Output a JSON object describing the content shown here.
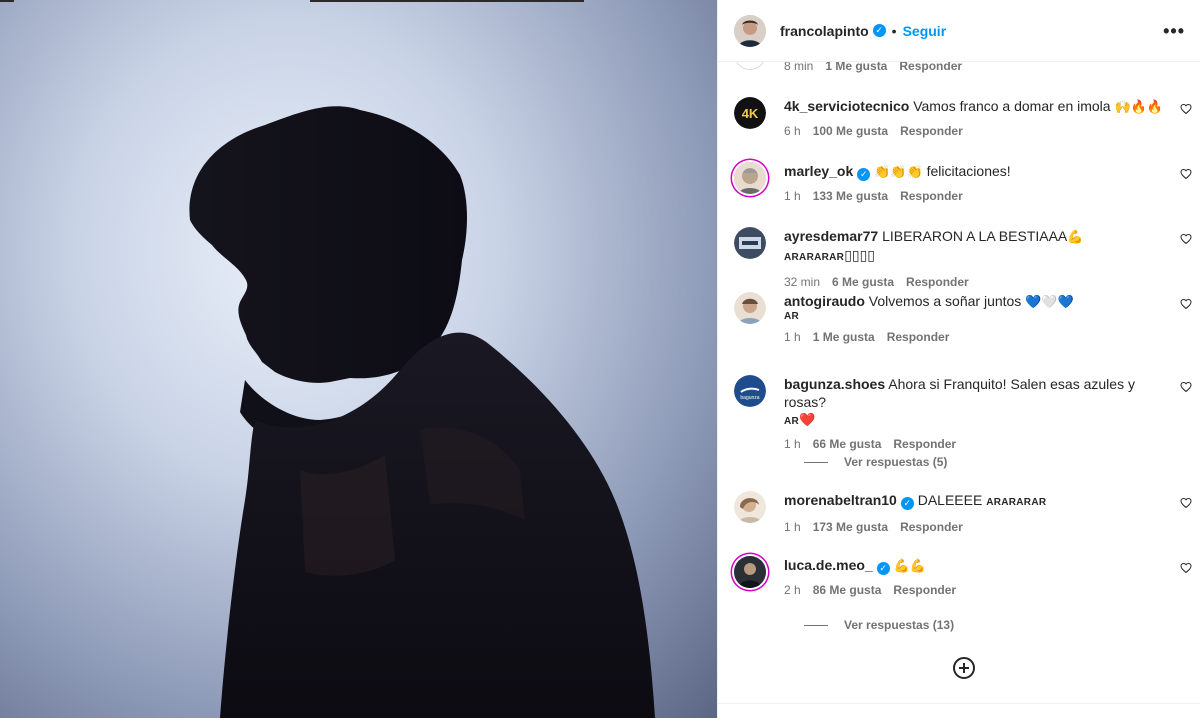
{
  "post": {
    "author": "francolapinto",
    "follow_label": "Seguir",
    "separator": "•",
    "more_label": "•••"
  },
  "first_comment_meta": {
    "time": "8 min",
    "likes": "1 Me gusta",
    "reply": "Responder"
  },
  "comments": [
    {
      "user": "4k_serviciotecnico",
      "text": "Vamos franco a domar en imola",
      "emoji": "🙌🔥🔥",
      "time": "6 h",
      "likes": "100 Me gusta",
      "reply": "Responder"
    },
    {
      "user": "marley_ok",
      "verified": true,
      "emoji_prefix": "👏👏👏",
      "text": "felicitaciones!",
      "time": "1 h",
      "likes": "133 Me gusta",
      "reply": "Responder"
    },
    {
      "user": "ayresdemar77",
      "text": "LIBERARON A LA BESTIAAA",
      "emoji": "💪",
      "flag": "ARARARAR",
      "trailing": "▯▯▯▯",
      "time": "32 min",
      "likes": "6 Me gusta",
      "reply": "Responder"
    },
    {
      "user": "antogiraudo",
      "text": "Volvemos a soñar juntos",
      "emoji": "💙🤍💙",
      "flag_line": "AR",
      "time": "1 h",
      "likes": "1 Me gusta",
      "reply": "Responder"
    },
    {
      "user": "bagunza.shoes",
      "text": "Ahora si Franquito! Salen esas azules y rosas?",
      "flag_line": "AR",
      "flag_emoji": "❤️",
      "time": "1 h",
      "likes": "66 Me gusta",
      "reply": "Responder",
      "view_replies": "Ver respuestas (5)"
    },
    {
      "user": "morenabeltran10",
      "verified": true,
      "text": "DALEEEE",
      "flag": "ARARARAR",
      "time": "1 h",
      "likes": "173 Me gusta",
      "reply": "Responder"
    },
    {
      "user": "luca.de.meo_",
      "verified": true,
      "emoji_prefix": "💪💪",
      "time": "2 h",
      "likes": "86 Me gusta",
      "reply": "Responder",
      "view_replies": "Ver respuestas (13)"
    }
  ],
  "icons": {
    "verified": "verified-badge-icon",
    "like": "heart-outline-icon",
    "load_more": "plus-circle-icon",
    "more": "more-options-icon"
  },
  "colors": {
    "link_blue": "#0095f6",
    "verified_blue": "#0095f6",
    "meta_gray": "#737373",
    "text_dark": "#262626",
    "story_ring": "#d300c5"
  }
}
